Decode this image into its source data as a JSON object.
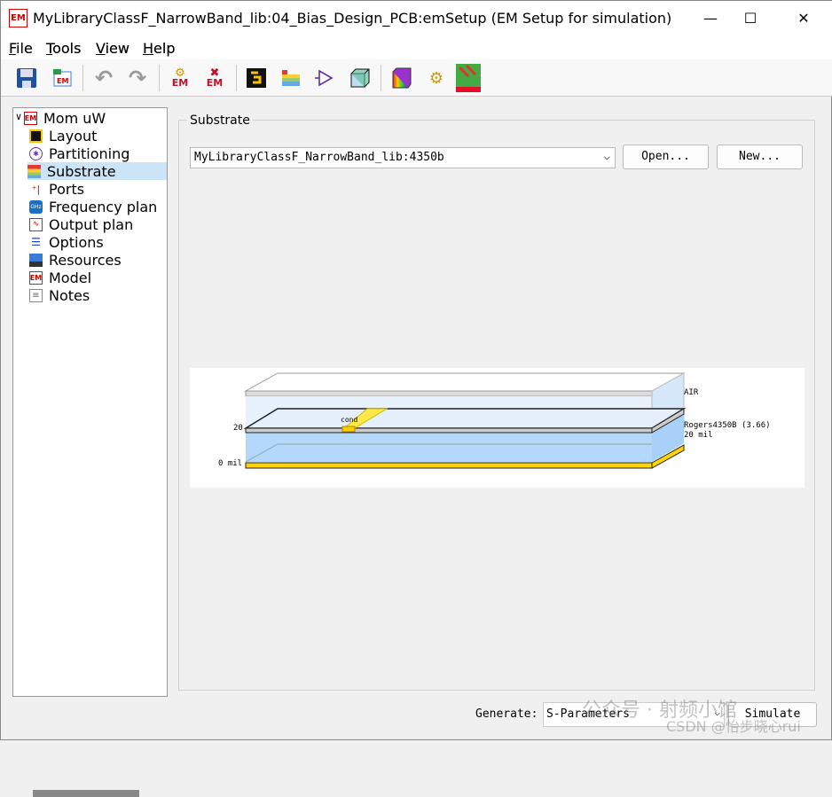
{
  "window": {
    "title": "MyLibraryClassF_NarrowBand_lib:04_Bias_Design_PCB:emSetup (EM Setup for simulation)",
    "icon_text": "EM",
    "minimize": "—",
    "maximize": "☐",
    "close": "✕"
  },
  "menu": [
    {
      "label": "File",
      "key": "F",
      "rest": "ile"
    },
    {
      "label": "Tools",
      "key": "T",
      "rest": "ools"
    },
    {
      "label": "View",
      "key": "V",
      "rest": "iew"
    },
    {
      "label": "Help",
      "key": "H",
      "rest": "elp"
    }
  ],
  "toolbar": [
    "save-icon",
    "em-load-icon",
    "undo-icon",
    "redo-icon",
    "em-simulate-icon",
    "em-stop-icon",
    "layout-icon",
    "substrate-icon",
    "schematic-symbol-icon",
    "3d-view-icon",
    "color-map-icon",
    "far-field-icon",
    "visualization-icon"
  ],
  "tree": {
    "root": "Mom uW",
    "items": [
      "Layout",
      "Partitioning",
      "Substrate",
      "Ports",
      "Frequency plan",
      "Output plan",
      "Options",
      "Resources",
      "Model",
      "Notes"
    ],
    "selected": "Substrate"
  },
  "substrate": {
    "group_label": "Substrate",
    "selected": "MyLibraryClassF_NarrowBand_lib:4350b",
    "open_label": "Open...",
    "new_label": "New...",
    "diagram": {
      "air": "AIR",
      "material": "Rogers4350B (3.66)",
      "thickness": "20 mil",
      "top_level": "20",
      "bottom_level": "0 mil",
      "conductor": "cond"
    }
  },
  "footer": {
    "generate_label": "Generate:",
    "generate_value": "S-Parameters",
    "simulate_label": "Simulate"
  },
  "watermark": {
    "line1": "公众号 · 射频小馆",
    "line2": "CSDN @怡步晓心rui"
  }
}
